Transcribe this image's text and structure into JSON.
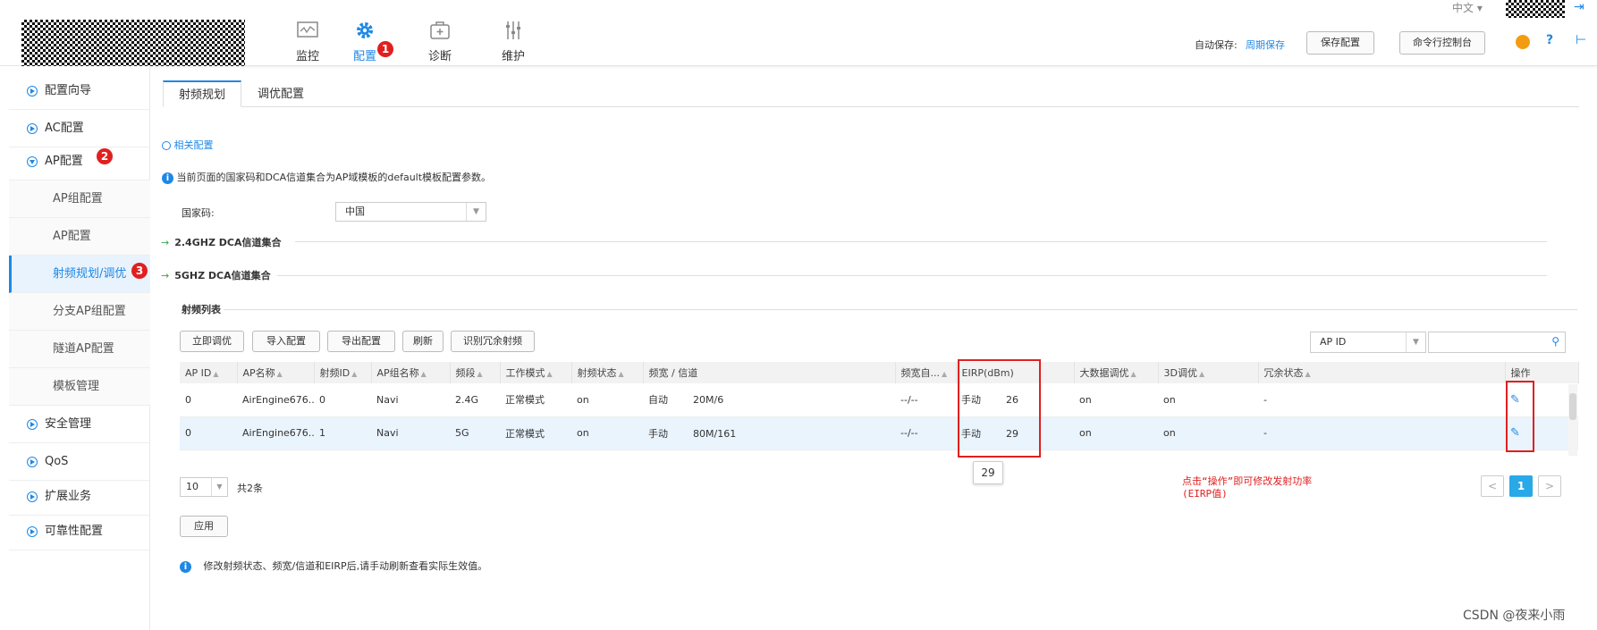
{
  "header": {
    "lang": "中文 ▾",
    "nav": [
      {
        "label": "监控",
        "icon": "monitor-icon"
      },
      {
        "label": "配置",
        "icon": "gear-icon",
        "active": true
      },
      {
        "label": "诊断",
        "icon": "medkit-icon"
      },
      {
        "label": "维护",
        "icon": "sliders-icon"
      }
    ],
    "nav_badge": "1",
    "autosave_label": "自动保存:",
    "autosave_value": "周期保存",
    "save_button": "保存配置",
    "console_button": "命令行控制台",
    "help_glyph": "?",
    "exit_glyph": "⊢"
  },
  "sidebar": {
    "items": [
      {
        "label": "配置向导"
      },
      {
        "label": "AC配置"
      },
      {
        "label": "AP配置",
        "badge": "2"
      },
      {
        "label": "安全管理"
      },
      {
        "label": "QoS"
      },
      {
        "label": "扩展业务"
      },
      {
        "label": "可靠性配置"
      }
    ],
    "sub_items": [
      {
        "label": "AP组配置"
      },
      {
        "label": "AP配置"
      },
      {
        "label": "射频规划/调优",
        "badge": "3",
        "active": true
      },
      {
        "label": "分支AP组配置"
      },
      {
        "label": "隧道AP配置"
      },
      {
        "label": "模板管理"
      }
    ]
  },
  "tabs": [
    "射频规划",
    "调优配置"
  ],
  "related_link": "相关配置",
  "info_text": "当前页面的国家码和DCA信道集合为AP域模板的default模板配置参数。",
  "country": {
    "label": "国家码:",
    "value": "中国"
  },
  "sections": [
    "2.4GHZ DCA信道集合",
    "5GHZ DCA信道集合"
  ],
  "list_title": "射频列表",
  "toolbar": [
    "立即调优",
    "导入配置",
    "导出配置",
    "刷新",
    "识别冗余射频"
  ],
  "search": {
    "field": "AP ID",
    "placeholder": ""
  },
  "table": {
    "columns": [
      "AP ID",
      "AP名称",
      "射频ID",
      "AP组名称",
      "频段",
      "工作模式",
      "射频状态",
      "频宽 / 信道",
      "频宽自...",
      "EIRP(dBm)",
      "大数据调优",
      "3D调优",
      "冗余状态",
      "操作"
    ],
    "rows": [
      {
        "ap_id": "0",
        "ap_name": "AirEngine676...",
        "radio_id": "0",
        "group": "Navi",
        "band": "2.4G",
        "mode": "正常模式",
        "status": "on",
        "bw_mode": "自动",
        "bw_val": "20M/6",
        "bw_auto": "--/--",
        "eirp_mode": "手动",
        "eirp_val": "26",
        "bigdata": "on",
        "d3": "on",
        "redundant": "-"
      },
      {
        "ap_id": "0",
        "ap_name": "AirEngine676...",
        "radio_id": "1",
        "group": "Navi",
        "band": "5G",
        "mode": "正常模式",
        "status": "on",
        "bw_mode": "手动",
        "bw_val": "80M/161",
        "bw_auto": "--/--",
        "eirp_mode": "手动",
        "eirp_val": "29",
        "bigdata": "on",
        "d3": "on",
        "redundant": "-"
      }
    ]
  },
  "tooltip": "29",
  "pagination": {
    "page_size": "10",
    "total": "共2条",
    "current": "1",
    "prev": "<",
    "next": ">"
  },
  "apply_button": "应用",
  "note": "修改射频状态、频宽/信道和EIRP后,请手动刷新查看实际生效值。",
  "annotation": "点击“操作”即可修改发射功率(EIRP值)",
  "watermark": "CSDN @夜来小雨",
  "colors": {
    "accent": "#1e88e5",
    "badge": "#e02020",
    "annotation": "#e02020"
  }
}
